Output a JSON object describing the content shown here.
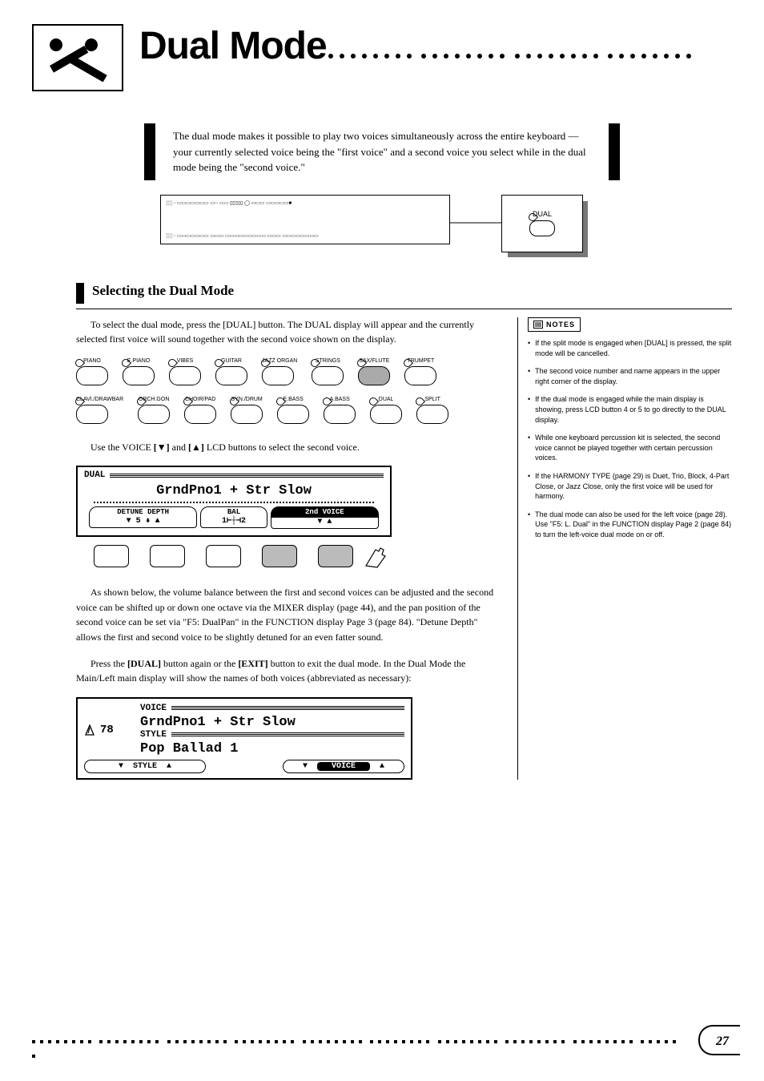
{
  "header": {
    "title": "Dual Mode"
  },
  "intro": "The dual mode makes it possible to play two voices simultaneously across the entire keyboard — your currently selected voice being the \"first voice\" and a second voice you select while in the dual mode being the \"second voice.\"",
  "callout": {
    "label": "DUAL"
  },
  "section": {
    "title": "Selecting the Dual Mode"
  },
  "body": {
    "p1": "To select the dual mode, press the [DUAL] button. The DUAL display will appear and the currently selected first voice will sound together with the second voice shown on the display.",
    "p2_a": "Use the VOICE ",
    "p2_b": " and ",
    "p2_c": " LCD buttons to select the second voice.",
    "p3_a": "As shown below, the volume balance between the first and second voices can be adjusted and the second voice can be shifted up or down one octave via the MIXER display (page 44), and the pan position of the second voice can be set via ",
    "p3_b": "\"F5: DualPan\"",
    "p3_c": " in the FUNCTION display Page 3 (page 84). \"Detune Depth\" allows the first and second voice to be slightly detuned for an even fatter sound.",
    "p4_a": "Press the ",
    "p4_b": "[DUAL]",
    "p4_c": " button again or the ",
    "p4_d": "[EXIT]",
    "p4_e": " button to exit the dual mode. In the Dual Mode the Main/Left main display will show the names of both voices (abbreviated as necessary):"
  },
  "voice_rows": {
    "row1": [
      "PIANO",
      "E.PIANO",
      "VIBES",
      "GUITAR",
      "JAZZ ORGAN",
      "STRINGS",
      "SAX/FLUTE",
      "TRUMPET"
    ],
    "row2": [
      "CLAVI./DRAWBAR",
      "ORCH.GON",
      "CHOIR/PAD",
      "SYN./DRUM",
      "E.BASS",
      "A.BASS",
      "DUAL",
      "SPLIT"
    ],
    "pressed_row1_index": 6,
    "dual_index_row2": 1
  },
  "lcd1": {
    "title": "DUAL",
    "voice": "GrndPno1 + Str Slow",
    "params": {
      "detune_label": "DETUNE DEPTH",
      "detune_value": "▼ 5 ⇞ ▲",
      "bal_label": "BAL",
      "bal_value": "1⊢┼⊣2",
      "second_label": "2nd VOICE",
      "second_value": "▼           ▲"
    }
  },
  "lcd2": {
    "tempo": "78",
    "voice_label": "VOICE",
    "voice": "GrndPno1 + Str Slow",
    "style_label": "STYLE",
    "style": "Pop Ballad 1",
    "style_pill": "STYLE",
    "voice_pill": "VOICE"
  },
  "notes": {
    "badge": "NOTES",
    "items": [
      "If the split mode is engaged when [DUAL] is pressed, the split mode will be cancelled.",
      "The second voice number and name appears in the upper right corner of the display.",
      "If the dual mode is engaged while the main display is showing, press LCD button 4 or 5 to go directly to the DUAL display.",
      "While one keyboard percussion kit is selected, the second voice cannot be played together with certain percussion voices.",
      "If the HARMONY TYPE (page 29) is Duet, Trio, Block, 4-Part Close, or Jazz Close, only the first voice will be used for harmony.",
      "The dual mode can also be used for the left voice (page 28). Use \"F5: L. Dual\" in the FUNCTION display Page 2 (page 84) to turn the left-voice dual mode on or off."
    ]
  },
  "page_number": "27"
}
